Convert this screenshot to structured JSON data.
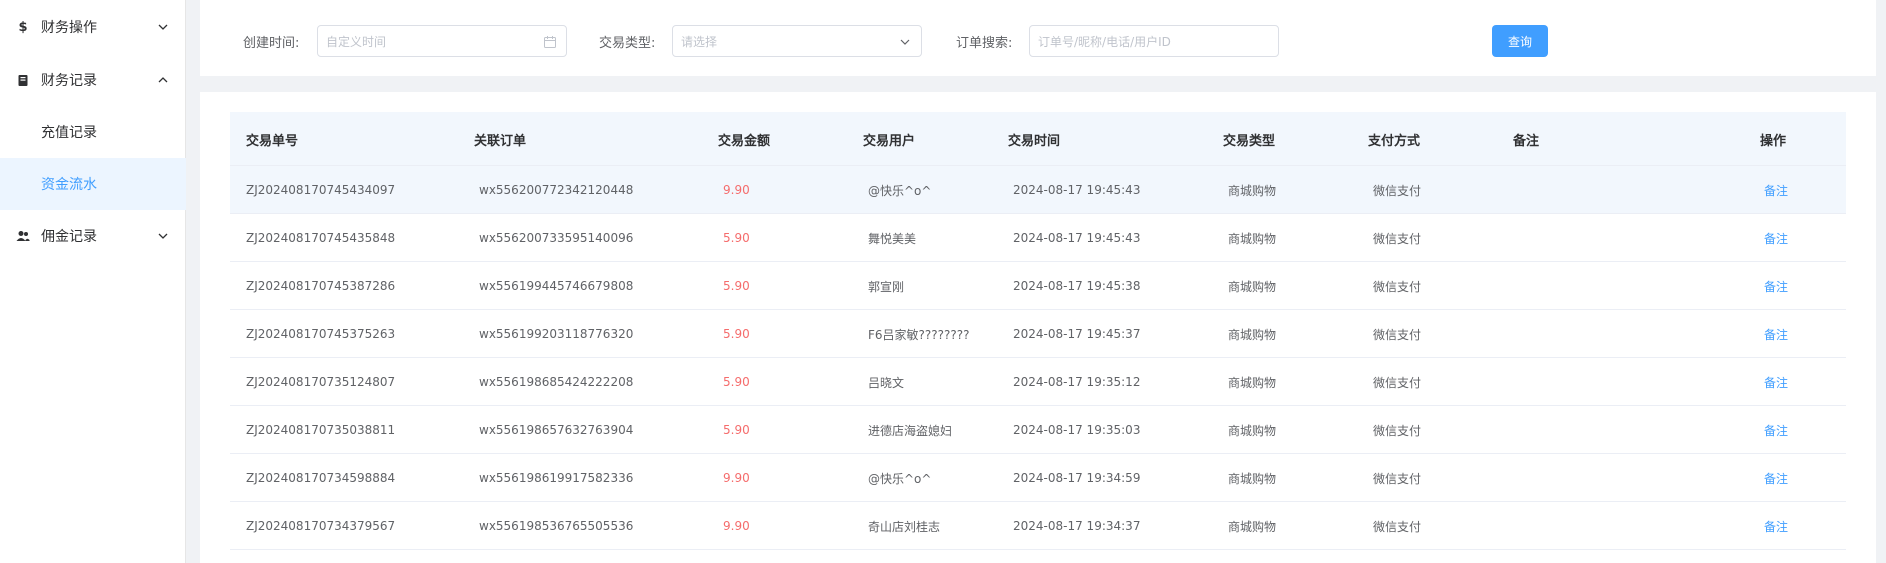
{
  "sidebar": {
    "items": [
      {
        "label": "财务操作",
        "icon": "dollar-icon",
        "expanded": false
      },
      {
        "label": "财务记录",
        "icon": "book-icon",
        "expanded": true,
        "children": [
          {
            "label": "充值记录",
            "active": false
          },
          {
            "label": "资金流水",
            "active": true
          }
        ]
      },
      {
        "label": "佣金记录",
        "icon": "users-icon",
        "expanded": false
      }
    ]
  },
  "filter": {
    "created_time_label": "创建时间:",
    "created_time_placeholder": "自定义时间",
    "trade_type_label": "交易类型:",
    "trade_type_placeholder": "请选择",
    "order_search_label": "订单搜索:",
    "order_search_placeholder": "订单号/昵称/电话/用户ID",
    "query_button": "查询"
  },
  "table": {
    "columns": [
      "交易单号",
      "关联订单",
      "交易金额",
      "交易用户",
      "交易时间",
      "交易类型",
      "支付方式",
      "备注",
      "操作"
    ],
    "rows": [
      {
        "id": "ZJ202408170745434097",
        "order": "wx556200772342120448",
        "amount": "9.90",
        "user": "@快乐^o^",
        "time": "2024-08-17 19:45:43",
        "type": "商城购物",
        "pay": "微信支付",
        "note": "",
        "action": "备注"
      },
      {
        "id": "ZJ202408170745435848",
        "order": "wx556200733595140096",
        "amount": "5.90",
        "user": "舞悦美美",
        "time": "2024-08-17 19:45:43",
        "type": "商城购物",
        "pay": "微信支付",
        "note": "",
        "action": "备注"
      },
      {
        "id": "ZJ202408170745387286",
        "order": "wx556199445746679808",
        "amount": "5.90",
        "user": "郭宣刚",
        "time": "2024-08-17 19:45:38",
        "type": "商城购物",
        "pay": "微信支付",
        "note": "",
        "action": "备注"
      },
      {
        "id": "ZJ202408170745375263",
        "order": "wx556199203118776320",
        "amount": "5.90",
        "user": "F6吕家敏????????",
        "time": "2024-08-17 19:45:37",
        "type": "商城购物",
        "pay": "微信支付",
        "note": "",
        "action": "备注"
      },
      {
        "id": "ZJ202408170735124807",
        "order": "wx556198685424222208",
        "amount": "5.90",
        "user": "吕晓文",
        "time": "2024-08-17 19:35:12",
        "type": "商城购物",
        "pay": "微信支付",
        "note": "",
        "action": "备注"
      },
      {
        "id": "ZJ202408170735038811",
        "order": "wx556198657632763904",
        "amount": "5.90",
        "user": "进德店海盗媳妇",
        "time": "2024-08-17 19:35:03",
        "type": "商城购物",
        "pay": "微信支付",
        "note": "",
        "action": "备注"
      },
      {
        "id": "ZJ202408170734598884",
        "order": "wx556198619917582336",
        "amount": "9.90",
        "user": "@快乐^o^",
        "time": "2024-08-17 19:34:59",
        "type": "商城购物",
        "pay": "微信支付",
        "note": "",
        "action": "备注"
      },
      {
        "id": "ZJ202408170734379567",
        "order": "wx556198536765505536",
        "amount": "9.90",
        "user": "奇山店刘桂志",
        "time": "2024-08-17 19:34:37",
        "type": "商城购物",
        "pay": "微信支付",
        "note": "",
        "action": "备注"
      }
    ]
  },
  "colors": {
    "accent": "#409eff",
    "amount": "#f56c6c",
    "active_bg": "#ecf5ff",
    "header_bg": "#f2f7fd"
  }
}
